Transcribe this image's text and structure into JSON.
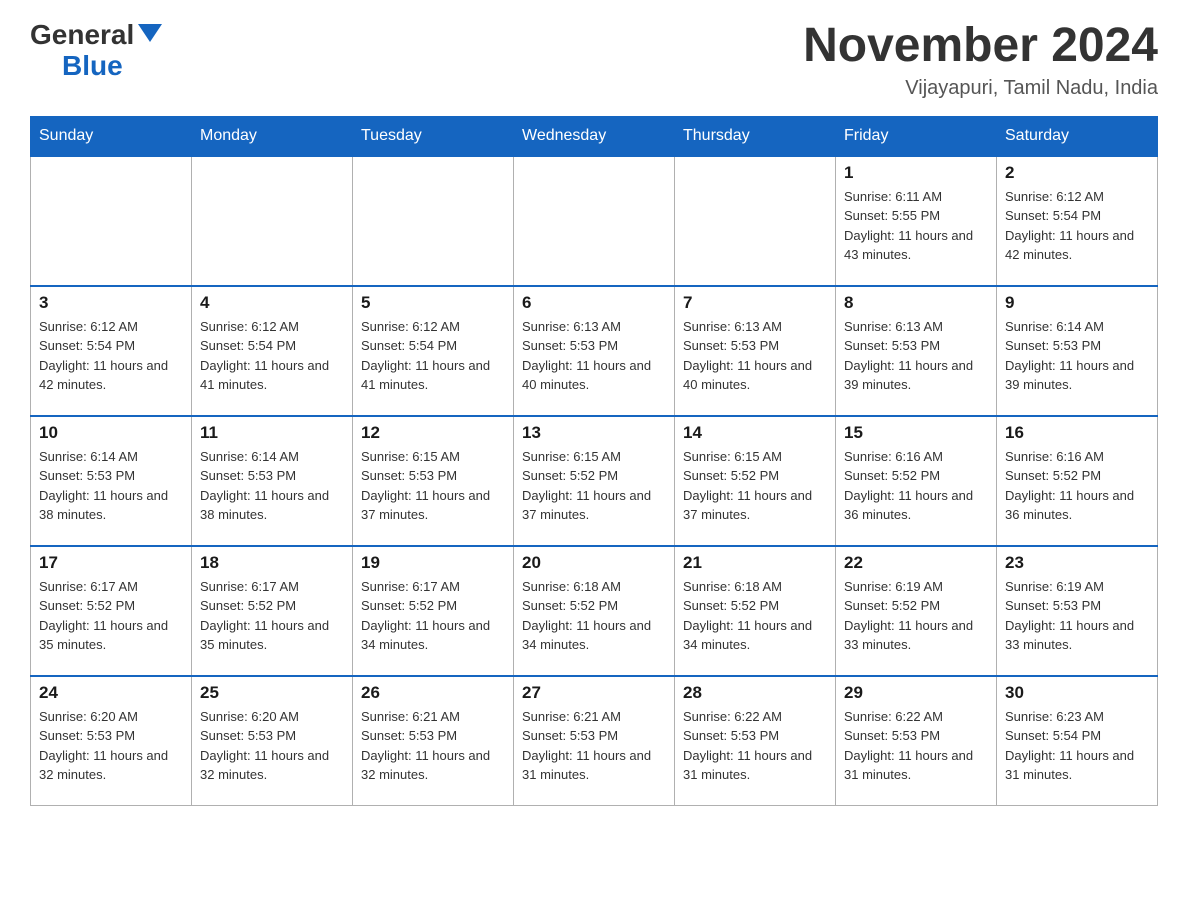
{
  "logo": {
    "general": "General",
    "blue": "Blue",
    "triangle": "▲"
  },
  "header": {
    "title": "November 2024",
    "subtitle": "Vijayapuri, Tamil Nadu, India"
  },
  "days": [
    "Sunday",
    "Monday",
    "Tuesday",
    "Wednesday",
    "Thursday",
    "Friday",
    "Saturday"
  ],
  "weeks": [
    [
      {
        "day": "",
        "info": ""
      },
      {
        "day": "",
        "info": ""
      },
      {
        "day": "",
        "info": ""
      },
      {
        "day": "",
        "info": ""
      },
      {
        "day": "",
        "info": ""
      },
      {
        "day": "1",
        "info": "Sunrise: 6:11 AM\nSunset: 5:55 PM\nDaylight: 11 hours and 43 minutes."
      },
      {
        "day": "2",
        "info": "Sunrise: 6:12 AM\nSunset: 5:54 PM\nDaylight: 11 hours and 42 minutes."
      }
    ],
    [
      {
        "day": "3",
        "info": "Sunrise: 6:12 AM\nSunset: 5:54 PM\nDaylight: 11 hours and 42 minutes."
      },
      {
        "day": "4",
        "info": "Sunrise: 6:12 AM\nSunset: 5:54 PM\nDaylight: 11 hours and 41 minutes."
      },
      {
        "day": "5",
        "info": "Sunrise: 6:12 AM\nSunset: 5:54 PM\nDaylight: 11 hours and 41 minutes."
      },
      {
        "day": "6",
        "info": "Sunrise: 6:13 AM\nSunset: 5:53 PM\nDaylight: 11 hours and 40 minutes."
      },
      {
        "day": "7",
        "info": "Sunrise: 6:13 AM\nSunset: 5:53 PM\nDaylight: 11 hours and 40 minutes."
      },
      {
        "day": "8",
        "info": "Sunrise: 6:13 AM\nSunset: 5:53 PM\nDaylight: 11 hours and 39 minutes."
      },
      {
        "day": "9",
        "info": "Sunrise: 6:14 AM\nSunset: 5:53 PM\nDaylight: 11 hours and 39 minutes."
      }
    ],
    [
      {
        "day": "10",
        "info": "Sunrise: 6:14 AM\nSunset: 5:53 PM\nDaylight: 11 hours and 38 minutes."
      },
      {
        "day": "11",
        "info": "Sunrise: 6:14 AM\nSunset: 5:53 PM\nDaylight: 11 hours and 38 minutes."
      },
      {
        "day": "12",
        "info": "Sunrise: 6:15 AM\nSunset: 5:53 PM\nDaylight: 11 hours and 37 minutes."
      },
      {
        "day": "13",
        "info": "Sunrise: 6:15 AM\nSunset: 5:52 PM\nDaylight: 11 hours and 37 minutes."
      },
      {
        "day": "14",
        "info": "Sunrise: 6:15 AM\nSunset: 5:52 PM\nDaylight: 11 hours and 37 minutes."
      },
      {
        "day": "15",
        "info": "Sunrise: 6:16 AM\nSunset: 5:52 PM\nDaylight: 11 hours and 36 minutes."
      },
      {
        "day": "16",
        "info": "Sunrise: 6:16 AM\nSunset: 5:52 PM\nDaylight: 11 hours and 36 minutes."
      }
    ],
    [
      {
        "day": "17",
        "info": "Sunrise: 6:17 AM\nSunset: 5:52 PM\nDaylight: 11 hours and 35 minutes."
      },
      {
        "day": "18",
        "info": "Sunrise: 6:17 AM\nSunset: 5:52 PM\nDaylight: 11 hours and 35 minutes."
      },
      {
        "day": "19",
        "info": "Sunrise: 6:17 AM\nSunset: 5:52 PM\nDaylight: 11 hours and 34 minutes."
      },
      {
        "day": "20",
        "info": "Sunrise: 6:18 AM\nSunset: 5:52 PM\nDaylight: 11 hours and 34 minutes."
      },
      {
        "day": "21",
        "info": "Sunrise: 6:18 AM\nSunset: 5:52 PM\nDaylight: 11 hours and 34 minutes."
      },
      {
        "day": "22",
        "info": "Sunrise: 6:19 AM\nSunset: 5:52 PM\nDaylight: 11 hours and 33 minutes."
      },
      {
        "day": "23",
        "info": "Sunrise: 6:19 AM\nSunset: 5:53 PM\nDaylight: 11 hours and 33 minutes."
      }
    ],
    [
      {
        "day": "24",
        "info": "Sunrise: 6:20 AM\nSunset: 5:53 PM\nDaylight: 11 hours and 32 minutes."
      },
      {
        "day": "25",
        "info": "Sunrise: 6:20 AM\nSunset: 5:53 PM\nDaylight: 11 hours and 32 minutes."
      },
      {
        "day": "26",
        "info": "Sunrise: 6:21 AM\nSunset: 5:53 PM\nDaylight: 11 hours and 32 minutes."
      },
      {
        "day": "27",
        "info": "Sunrise: 6:21 AM\nSunset: 5:53 PM\nDaylight: 11 hours and 31 minutes."
      },
      {
        "day": "28",
        "info": "Sunrise: 6:22 AM\nSunset: 5:53 PM\nDaylight: 11 hours and 31 minutes."
      },
      {
        "day": "29",
        "info": "Sunrise: 6:22 AM\nSunset: 5:53 PM\nDaylight: 11 hours and 31 minutes."
      },
      {
        "day": "30",
        "info": "Sunrise: 6:23 AM\nSunset: 5:54 PM\nDaylight: 11 hours and 31 minutes."
      }
    ]
  ]
}
